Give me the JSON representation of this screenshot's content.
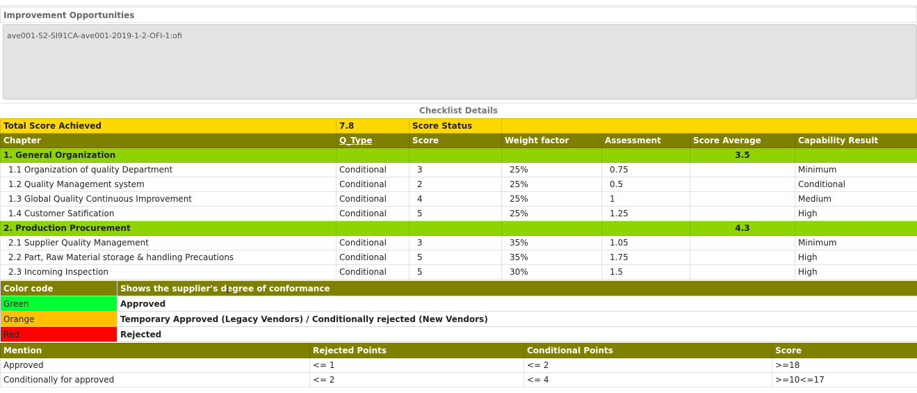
{
  "ofi": {
    "heading": "Improvement Opportunities",
    "value": "ave001-S2-SI91CA-ave001-2019-1-2-OFI-1:ofi"
  },
  "checklist": {
    "heading": "Checklist Details",
    "total_label": "Total Score Achieved",
    "total_value": "7.8",
    "score_status_label": "Score Status",
    "columns": [
      "Chapter",
      "Q_Type",
      "Score",
      "Weight factor",
      "Assessment",
      "Score Average",
      "Capability Result"
    ],
    "chapters": [
      {
        "title": "1. General Organization",
        "average": "3.5",
        "rows": [
          {
            "chapter": "1.1 Organization of quality Department",
            "qtype": "Conditional",
            "score": "3",
            "weight": "25%",
            "assessment": "0.75",
            "result": "Minimum"
          },
          {
            "chapter": "1.2 Quality Management system",
            "qtype": "Conditional",
            "score": "2",
            "weight": "25%",
            "assessment": "0.5",
            "result": "Conditional"
          },
          {
            "chapter": "1.3 Global Quality Continuous Improvement",
            "qtype": "Conditional",
            "score": "4",
            "weight": "25%",
            "assessment": "1",
            "result": "Medium"
          },
          {
            "chapter": "1.4 Customer Satification",
            "qtype": "Conditional",
            "score": "5",
            "weight": "25%",
            "assessment": "1.25",
            "result": "High"
          }
        ]
      },
      {
        "title": "2. Production Procurement",
        "average": "4.3",
        "rows": [
          {
            "chapter": "2.1 Supplier Quality Management",
            "qtype": "Conditional",
            "score": "3",
            "weight": "35%",
            "assessment": "1.05",
            "result": "Minimum"
          },
          {
            "chapter": "2.2 Part, Raw Material storage & handling Precautions",
            "qtype": "Conditional",
            "score": "5",
            "weight": "35%",
            "assessment": "1.75",
            "result": "High"
          },
          {
            "chapter": "2.3 Incoming Inspection",
            "qtype": "Conditional",
            "score": "5",
            "weight": "30%",
            "assessment": "1.5",
            "result": "High"
          }
        ]
      }
    ]
  },
  "legend": {
    "header_label": "Color code",
    "header_desc": "Shows the supplier's degree of conformance",
    "items": [
      {
        "color": "Green",
        "desc": "Approved"
      },
      {
        "color": "Orange",
        "desc": "Temporary Approved (Legacy Vendors) / Conditionally rejected (New Vendors)"
      },
      {
        "color": "Red",
        "desc": "Rejected"
      }
    ]
  },
  "mention": {
    "columns": [
      "Mention",
      "Rejected Points",
      "Conditional Points",
      "Score"
    ],
    "rows": [
      {
        "mention": "Approved",
        "rejected": "<= 1",
        "conditional": "<= 2",
        "score": ">=18"
      },
      {
        "mention": "Conditionally for approved",
        "rejected": "<= 2",
        "conditional": "<= 4",
        "score": ">=10<=17"
      }
    ]
  },
  "colors": {
    "header_yellow": "#ffd800",
    "header_olive": "#808000",
    "chapter_green": "#8fd400",
    "legend_green": "#00ff33",
    "legend_orange": "#ffc000",
    "legend_red": "#ff0000"
  }
}
